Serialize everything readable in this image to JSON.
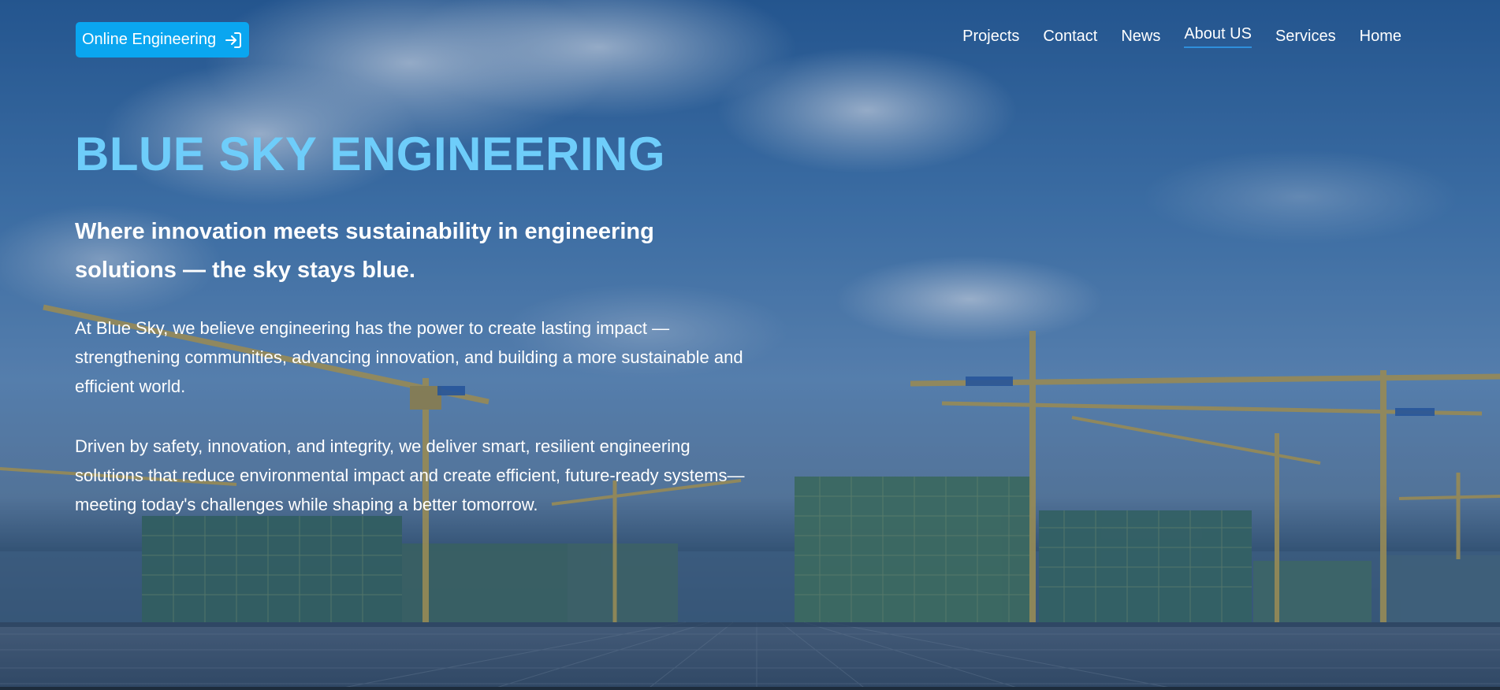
{
  "header": {
    "login_button": {
      "label": "Online Engineering",
      "icon": "sign-in-icon",
      "color": "#0aa6f0"
    },
    "nav": [
      {
        "label": "Projects",
        "active": false
      },
      {
        "label": "Contact",
        "active": false
      },
      {
        "label": "News",
        "active": false
      },
      {
        "label": "About US",
        "active": true
      },
      {
        "label": "Services",
        "active": false
      },
      {
        "label": "Home",
        "active": false
      }
    ]
  },
  "hero": {
    "title": "BLUE SKY ENGINEERING",
    "title_color": "#6ecdfa",
    "subtitle": "Where innovation meets sustainability in engineering solutions — the sky stays blue.",
    "paragraphs": [
      "At Blue Sky, we believe engineering has the power to create lasting impact — strengthening communities, advancing innovation, and building a more sustainable and efficient world.",
      "Driven by safety, innovation, and integrity, we deliver smart, resilient engineering solutions that reduce environmental impact and create efficient, future-ready systems—meeting today's challenges while shaping a better tomorrow."
    ]
  }
}
